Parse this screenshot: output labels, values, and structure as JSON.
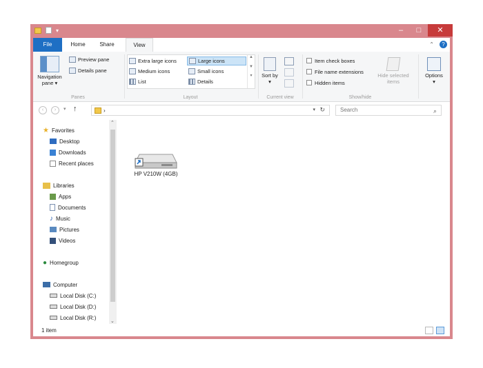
{
  "tabs": {
    "file": "File",
    "home": "Home",
    "share": "Share",
    "view": "View"
  },
  "ribbon": {
    "panes": {
      "navigation_pane": "Navigation pane",
      "preview_pane": "Preview pane",
      "details_pane": "Details pane",
      "label": "Panes"
    },
    "layout": {
      "extra_large": "Extra large icons",
      "large": "Large icons",
      "medium": "Medium icons",
      "small": "Small icons",
      "list": "List",
      "details": "Details",
      "label": "Layout"
    },
    "current_view": {
      "sort_by": "Sort by",
      "label": "Current view"
    },
    "show_hide": {
      "item_check_boxes": "Item check boxes",
      "file_name_extensions": "File name extensions",
      "hidden_items": "Hidden items",
      "hide_selected_items": "Hide selected items",
      "label": "Show/hide"
    },
    "options": "Options"
  },
  "address": {
    "path_sep": "›",
    "search_placeholder": "Search"
  },
  "nav": {
    "favorites": "Favorites",
    "desktop": "Desktop",
    "downloads": "Downloads",
    "recent": "Recent places",
    "libraries": "Libraries",
    "apps": "Apps",
    "documents": "Documents",
    "music": "Music",
    "pictures": "Pictures",
    "videos": "Videos",
    "homegroup": "Homegroup",
    "computer": "Computer",
    "disk_c": "Local Disk (C:)",
    "disk_d": "Local Disk (D:)",
    "disk_r": "Local Disk (R:)"
  },
  "content": {
    "drive_label": "HP V210W (4GB)"
  },
  "status": {
    "item_count": "1 item"
  },
  "colors": {
    "file_tab": "#1e6fc4",
    "window_border": "#d9878d",
    "close_button": "#c73b3b",
    "selection": "#cce4f7"
  }
}
